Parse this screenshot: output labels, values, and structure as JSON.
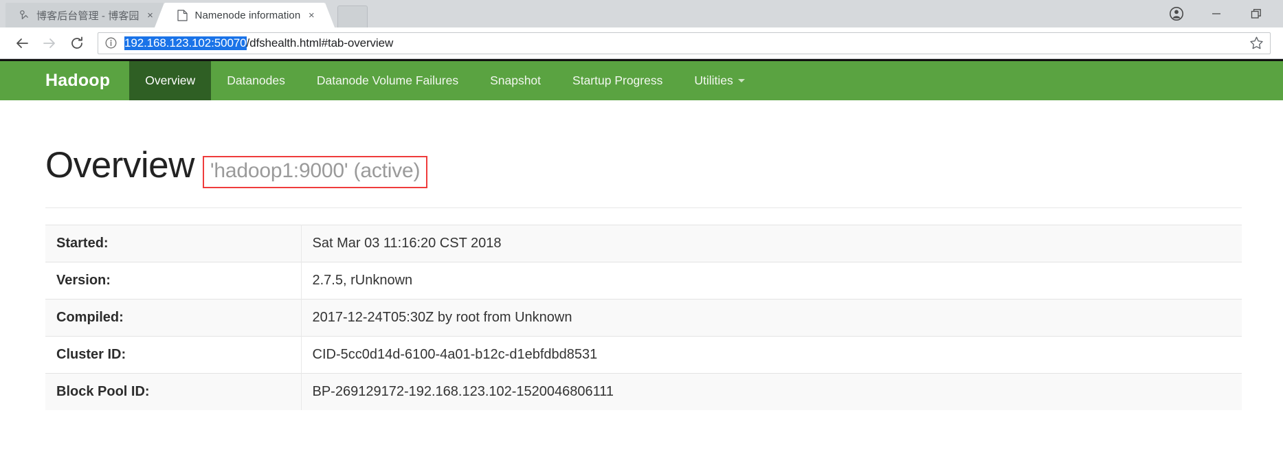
{
  "browser": {
    "tabs": [
      {
        "title": "博客后台管理 - 博客园",
        "favicon": "bookmark-person-icon",
        "active": false,
        "close_label": "×"
      },
      {
        "title": "Namenode information",
        "favicon": "page-document-icon",
        "active": true,
        "close_label": "×"
      }
    ],
    "window_controls": {
      "profile_label": "profile-avatar-icon",
      "minimize_label": "minimize-icon",
      "restore_label": "restore-icon"
    },
    "toolbar": {
      "back_label": "back-arrow-icon",
      "forward_label": "forward-arrow-icon",
      "reload_label": "reload-icon",
      "site_info_label": "site-info-icon",
      "star_label": "bookmark-star-icon"
    },
    "address_bar": {
      "url_selected": "192.168.123.102:50070",
      "url_rest": "/dfshealth.html#tab-overview",
      "full_url": "192.168.123.102:50070/dfshealth.html#tab-overview",
      "selection_color": "#1a73e8"
    }
  },
  "navbar": {
    "brand": "Hadoop",
    "background_color": "#5aa341",
    "active_color": "#2f5f24",
    "items": [
      {
        "label": "Overview",
        "active": true,
        "dropdown": false
      },
      {
        "label": "Datanodes",
        "active": false,
        "dropdown": false
      },
      {
        "label": "Datanode Volume Failures",
        "active": false,
        "dropdown": false
      },
      {
        "label": "Snapshot",
        "active": false,
        "dropdown": false
      },
      {
        "label": "Startup Progress",
        "active": false,
        "dropdown": false
      },
      {
        "label": "Utilities",
        "active": false,
        "dropdown": true
      }
    ]
  },
  "page": {
    "title": "Overview",
    "subtitle": "'hadoop1:9000' (active)",
    "highlight_color": "#ef3b3b",
    "table": {
      "rows": [
        {
          "key": "Started:",
          "value": "Sat Mar 03 11:16:20 CST 2018"
        },
        {
          "key": "Version:",
          "value": "2.7.5, rUnknown"
        },
        {
          "key": "Compiled:",
          "value": "2017-12-24T05:30Z by root from Unknown"
        },
        {
          "key": "Cluster ID:",
          "value": "CID-5cc0d14d-6100-4a01-b12c-d1ebfdbd8531"
        },
        {
          "key": "Block Pool ID:",
          "value": "BP-269129172-192.168.123.102-1520046806111"
        }
      ]
    }
  }
}
